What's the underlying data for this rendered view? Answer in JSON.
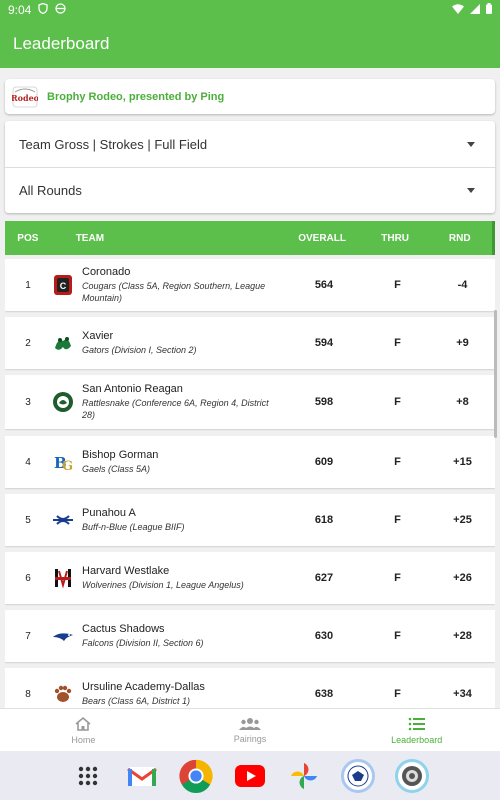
{
  "status": {
    "time": "9:04"
  },
  "appbar": {
    "title": "Leaderboard"
  },
  "event": {
    "title": "Brophy Rodeo, presented by Ping",
    "logo_text": "Rodeo"
  },
  "filters": {
    "scoring": "Team Gross | Strokes | Full Field",
    "round": "All Rounds"
  },
  "table": {
    "headers": {
      "pos": "POS",
      "team": "TEAM",
      "overall": "OVERALL",
      "thru": "THRU",
      "rnd": "RND"
    },
    "rows": [
      {
        "pos": "1",
        "team": "Coronado",
        "sub": "Cougars (Class 5A, Region Southern, League Mountain)",
        "overall": "564",
        "thru": "F",
        "rnd": "-4",
        "logo": "coronado-logo-icon"
      },
      {
        "pos": "2",
        "team": "Xavier",
        "sub": "Gators (Division I, Section 2)",
        "overall": "594",
        "thru": "F",
        "rnd": "+9",
        "logo": "xavier-gator-logo-icon"
      },
      {
        "pos": "3",
        "team": "San Antonio Reagan",
        "sub": "Rattlesnake (Conference 6A, Region 4, District 28)",
        "overall": "598",
        "thru": "F",
        "rnd": "+8",
        "logo": "reagan-logo-icon"
      },
      {
        "pos": "4",
        "team": "Bishop Gorman",
        "sub": "Gaels (Class 5A)",
        "overall": "609",
        "thru": "F",
        "rnd": "+15",
        "logo": "bishop-gorman-logo-icon"
      },
      {
        "pos": "5",
        "team": "Punahou A",
        "sub": "Buff-n-Blue (League BIIF)",
        "overall": "618",
        "thru": "F",
        "rnd": "+25",
        "logo": "punahou-logo-icon"
      },
      {
        "pos": "6",
        "team": "Harvard Westlake",
        "sub": "Wolverines (Division 1, League Angelus)",
        "overall": "627",
        "thru": "F",
        "rnd": "+26",
        "logo": "harvard-westlake-logo-icon"
      },
      {
        "pos": "7",
        "team": "Cactus Shadows",
        "sub": "Falcons (Division II, Section 6)",
        "overall": "630",
        "thru": "F",
        "rnd": "+28",
        "logo": "cactus-shadows-logo-icon"
      },
      {
        "pos": "8",
        "team": "Ursuline Academy-Dallas",
        "sub": "Bears (Class 6A, District 1)",
        "overall": "638",
        "thru": "F",
        "rnd": "+34",
        "logo": "bear-paw-logo-icon"
      }
    ]
  },
  "nav": {
    "items": [
      {
        "label": "Home",
        "icon": "home-icon",
        "active": false
      },
      {
        "label": "Pairings",
        "icon": "people-icon",
        "active": false
      },
      {
        "label": "Leaderboard",
        "icon": "list-icon",
        "active": true
      }
    ]
  },
  "dock": {
    "apps": [
      "app-drawer-icon",
      "gmail-icon",
      "chrome-icon",
      "youtube-icon",
      "photos-icon",
      "app-badge-icon",
      "app-seal-icon"
    ]
  },
  "colors": {
    "primary": "#5cbf4c",
    "accent_text": "#4caf3a"
  }
}
